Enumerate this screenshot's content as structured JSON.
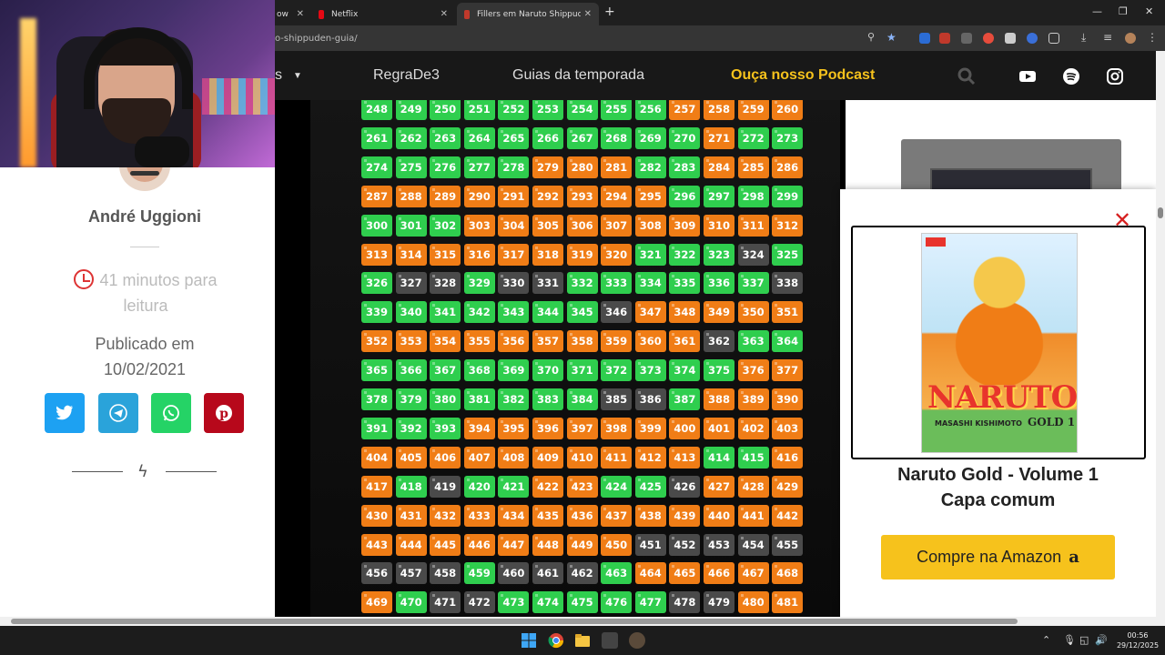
{
  "browser": {
    "tabs": [
      {
        "label": "ow",
        "active": false
      },
      {
        "label": "Netflix",
        "active": false
      },
      {
        "label": "Fillers em Naruto Shippuden: su",
        "active": true
      }
    ],
    "url": "o-shippuden-guia/"
  },
  "nav": {
    "partial_item": "s",
    "items": [
      "RegraDe3",
      "Guias da temporada"
    ],
    "podcast": "Ouça nosso Podcast"
  },
  "sidebar": {
    "author": "André Uggioni",
    "read_time": "41 minutos para leitura",
    "published_label": "Publicado em",
    "published_date": "10/02/2021"
  },
  "legend_colors": {
    "canon": "#2fce4e",
    "filler": "#f07d16",
    "mixed": "#4a4a4a"
  },
  "episodes": {
    "rows": [
      [
        [
          248,
          "c"
        ],
        [
          249,
          "c"
        ],
        [
          250,
          "c"
        ],
        [
          251,
          "c"
        ],
        [
          252,
          "c"
        ],
        [
          253,
          "c"
        ],
        [
          254,
          "c"
        ],
        [
          255,
          "c"
        ],
        [
          256,
          "c"
        ],
        [
          257,
          "f"
        ],
        [
          258,
          "f"
        ],
        [
          259,
          "f"
        ],
        [
          260,
          "f"
        ]
      ],
      [
        [
          261,
          "c"
        ],
        [
          262,
          "c"
        ],
        [
          263,
          "c"
        ],
        [
          264,
          "c"
        ],
        [
          265,
          "c"
        ],
        [
          266,
          "c"
        ],
        [
          267,
          "c"
        ],
        [
          268,
          "c"
        ],
        [
          269,
          "c"
        ],
        [
          270,
          "c"
        ],
        [
          271,
          "f"
        ],
        [
          272,
          "c"
        ],
        [
          273,
          "c"
        ]
      ],
      [
        [
          274,
          "c"
        ],
        [
          275,
          "c"
        ],
        [
          276,
          "c"
        ],
        [
          277,
          "c"
        ],
        [
          278,
          "c"
        ],
        [
          279,
          "f"
        ],
        [
          280,
          "f"
        ],
        [
          281,
          "f"
        ],
        [
          282,
          "c"
        ],
        [
          283,
          "c"
        ],
        [
          284,
          "f"
        ],
        [
          285,
          "f"
        ],
        [
          286,
          "f"
        ]
      ],
      [
        [
          287,
          "f"
        ],
        [
          288,
          "f"
        ],
        [
          289,
          "f"
        ],
        [
          290,
          "f"
        ],
        [
          291,
          "f"
        ],
        [
          292,
          "f"
        ],
        [
          293,
          "f"
        ],
        [
          294,
          "f"
        ],
        [
          295,
          "f"
        ],
        [
          296,
          "c"
        ],
        [
          297,
          "c"
        ],
        [
          298,
          "c"
        ],
        [
          299,
          "c"
        ]
      ],
      [
        [
          300,
          "c"
        ],
        [
          301,
          "c"
        ],
        [
          302,
          "c"
        ],
        [
          303,
          "f"
        ],
        [
          304,
          "f"
        ],
        [
          305,
          "f"
        ],
        [
          306,
          "f"
        ],
        [
          307,
          "f"
        ],
        [
          308,
          "f"
        ],
        [
          309,
          "f"
        ],
        [
          310,
          "f"
        ],
        [
          311,
          "f"
        ],
        [
          312,
          "f"
        ]
      ],
      [
        [
          313,
          "f"
        ],
        [
          314,
          "f"
        ],
        [
          315,
          "f"
        ],
        [
          316,
          "f"
        ],
        [
          317,
          "f"
        ],
        [
          318,
          "f"
        ],
        [
          319,
          "f"
        ],
        [
          320,
          "f"
        ],
        [
          321,
          "c"
        ],
        [
          322,
          "c"
        ],
        [
          323,
          "c"
        ],
        [
          324,
          "m"
        ],
        [
          325,
          "c"
        ]
      ],
      [
        [
          326,
          "c"
        ],
        [
          327,
          "m"
        ],
        [
          328,
          "m"
        ],
        [
          329,
          "c"
        ],
        [
          330,
          "m"
        ],
        [
          331,
          "m"
        ],
        [
          332,
          "c"
        ],
        [
          333,
          "c"
        ],
        [
          334,
          "c"
        ],
        [
          335,
          "c"
        ],
        [
          336,
          "c"
        ],
        [
          337,
          "c"
        ],
        [
          338,
          "m"
        ]
      ],
      [
        [
          339,
          "c"
        ],
        [
          340,
          "c"
        ],
        [
          341,
          "c"
        ],
        [
          342,
          "c"
        ],
        [
          343,
          "c"
        ],
        [
          344,
          "c"
        ],
        [
          345,
          "c"
        ],
        [
          346,
          "m"
        ],
        [
          347,
          "f"
        ],
        [
          348,
          "f"
        ],
        [
          349,
          "f"
        ],
        [
          350,
          "f"
        ],
        [
          351,
          "f"
        ]
      ],
      [
        [
          352,
          "f"
        ],
        [
          353,
          "f"
        ],
        [
          354,
          "f"
        ],
        [
          355,
          "f"
        ],
        [
          356,
          "f"
        ],
        [
          357,
          "f"
        ],
        [
          358,
          "f"
        ],
        [
          359,
          "f"
        ],
        [
          360,
          "f"
        ],
        [
          361,
          "f"
        ],
        [
          362,
          "m"
        ],
        [
          363,
          "c"
        ],
        [
          364,
          "c"
        ]
      ],
      [
        [
          365,
          "c"
        ],
        [
          366,
          "c"
        ],
        [
          367,
          "c"
        ],
        [
          368,
          "c"
        ],
        [
          369,
          "c"
        ],
        [
          370,
          "c"
        ],
        [
          371,
          "c"
        ],
        [
          372,
          "c"
        ],
        [
          373,
          "c"
        ],
        [
          374,
          "c"
        ],
        [
          375,
          "c"
        ],
        [
          376,
          "f"
        ],
        [
          377,
          "f"
        ]
      ],
      [
        [
          378,
          "c"
        ],
        [
          379,
          "c"
        ],
        [
          380,
          "c"
        ],
        [
          381,
          "c"
        ],
        [
          382,
          "c"
        ],
        [
          383,
          "c"
        ],
        [
          384,
          "c"
        ],
        [
          385,
          "m"
        ],
        [
          386,
          "m"
        ],
        [
          387,
          "c"
        ],
        [
          388,
          "f"
        ],
        [
          389,
          "f"
        ],
        [
          390,
          "f"
        ]
      ],
      [
        [
          391,
          "c"
        ],
        [
          392,
          "c"
        ],
        [
          393,
          "c"
        ],
        [
          394,
          "f"
        ],
        [
          395,
          "f"
        ],
        [
          396,
          "f"
        ],
        [
          397,
          "f"
        ],
        [
          398,
          "f"
        ],
        [
          399,
          "f"
        ],
        [
          400,
          "f"
        ],
        [
          401,
          "f"
        ],
        [
          402,
          "f"
        ],
        [
          403,
          "f"
        ]
      ],
      [
        [
          404,
          "f"
        ],
        [
          405,
          "f"
        ],
        [
          406,
          "f"
        ],
        [
          407,
          "f"
        ],
        [
          408,
          "f"
        ],
        [
          409,
          "f"
        ],
        [
          410,
          "f"
        ],
        [
          411,
          "f"
        ],
        [
          412,
          "f"
        ],
        [
          413,
          "f"
        ],
        [
          414,
          "c"
        ],
        [
          415,
          "c"
        ],
        [
          416,
          "f"
        ]
      ],
      [
        [
          417,
          "f"
        ],
        [
          418,
          "c"
        ],
        [
          419,
          "m"
        ],
        [
          420,
          "c"
        ],
        [
          421,
          "c"
        ],
        [
          422,
          "f"
        ],
        [
          423,
          "f"
        ],
        [
          424,
          "c"
        ],
        [
          425,
          "c"
        ],
        [
          426,
          "m"
        ],
        [
          427,
          "f"
        ],
        [
          428,
          "f"
        ],
        [
          429,
          "f"
        ]
      ],
      [
        [
          430,
          "f"
        ],
        [
          431,
          "f"
        ],
        [
          432,
          "f"
        ],
        [
          433,
          "f"
        ],
        [
          434,
          "f"
        ],
        [
          435,
          "f"
        ],
        [
          436,
          "f"
        ],
        [
          437,
          "f"
        ],
        [
          438,
          "f"
        ],
        [
          439,
          "f"
        ],
        [
          440,
          "f"
        ],
        [
          441,
          "f"
        ],
        [
          442,
          "f"
        ]
      ],
      [
        [
          443,
          "f"
        ],
        [
          444,
          "f"
        ],
        [
          445,
          "f"
        ],
        [
          446,
          "f"
        ],
        [
          447,
          "f"
        ],
        [
          448,
          "f"
        ],
        [
          449,
          "f"
        ],
        [
          450,
          "f"
        ],
        [
          451,
          "m"
        ],
        [
          452,
          "m"
        ],
        [
          453,
          "m"
        ],
        [
          454,
          "m"
        ],
        [
          455,
          "m"
        ]
      ],
      [
        [
          456,
          "m"
        ],
        [
          457,
          "m"
        ],
        [
          458,
          "m"
        ],
        [
          459,
          "c"
        ],
        [
          460,
          "m"
        ],
        [
          461,
          "m"
        ],
        [
          462,
          "m"
        ],
        [
          463,
          "c"
        ],
        [
          464,
          "f"
        ],
        [
          465,
          "f"
        ],
        [
          466,
          "f"
        ],
        [
          467,
          "f"
        ],
        [
          468,
          "f"
        ]
      ],
      [
        [
          469,
          "f"
        ],
        [
          470,
          "c"
        ],
        [
          471,
          "m"
        ],
        [
          472,
          "m"
        ],
        [
          473,
          "c"
        ],
        [
          474,
          "c"
        ],
        [
          475,
          "c"
        ],
        [
          476,
          "c"
        ],
        [
          477,
          "c"
        ],
        [
          478,
          "m"
        ],
        [
          479,
          "m"
        ],
        [
          480,
          "f"
        ],
        [
          481,
          "f"
        ]
      ]
    ]
  },
  "promo": {
    "cover_title": "NARUTO",
    "cover_author": "MASASHI KISHIMOTO",
    "cover_volume": "GOLD 1",
    "title_line1": "Naruto Gold - Volume 1",
    "title_line2": "Capa comum",
    "button": "Compre na Amazon",
    "amazon_glyph": "a"
  },
  "taskbar": {
    "time": "00:56",
    "date": "29/12/2025"
  }
}
